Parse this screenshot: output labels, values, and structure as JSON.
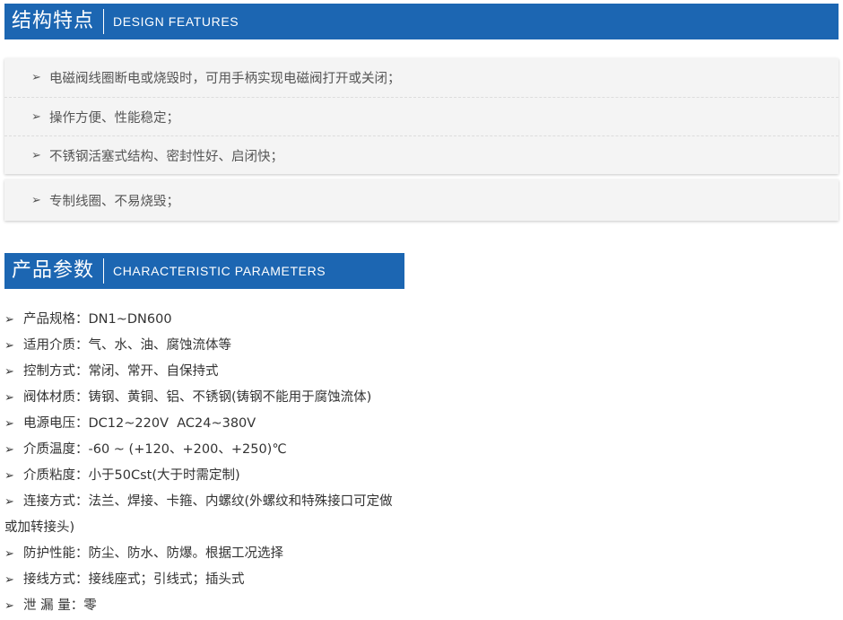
{
  "features_section": {
    "title_zh": "结构特点",
    "title_en": "DESIGN FEATURES",
    "arrow_icon": "arrow-right-icon",
    "items": [
      "电磁阀线圈断电或烧毁时，可用手柄实现电磁阀打开或关闭；",
      "操作方便、性能稳定；",
      "不锈钢活塞式结构、密封性好、启闭快；",
      "专制线圈、不易烧毁；"
    ]
  },
  "params_section": {
    "title_zh": "产品参数",
    "title_en": "CHARACTERISTIC PARAMETERS",
    "items": [
      "产品规格：DN1~DN600",
      "适用介质：气、水、油、腐蚀流体等",
      "控制方式：常闭、常开、自保持式",
      "阀体材质：铸钢、黄铜、铝、不锈钢(铸钢不能用于腐蚀流体)",
      "电源电压：DC12~220V  AC24~380V",
      "介质温度：-60 ~ (+120、+200、+250)℃",
      "介质粘度：小于50Cst(大于时需定制)",
      "连接方式：法兰、焊接、卡箍、内螺纹(外螺纹和特殊接口可定做或加转接头)",
      "防护性能：防尘、防水、防爆。根据工况选择",
      "接线方式：接线座式；引线式；插头式",
      "泄 漏 量：零"
    ]
  },
  "colors": {
    "header_bg": "#1c66b2",
    "box_bg": "#f4f4f4"
  }
}
